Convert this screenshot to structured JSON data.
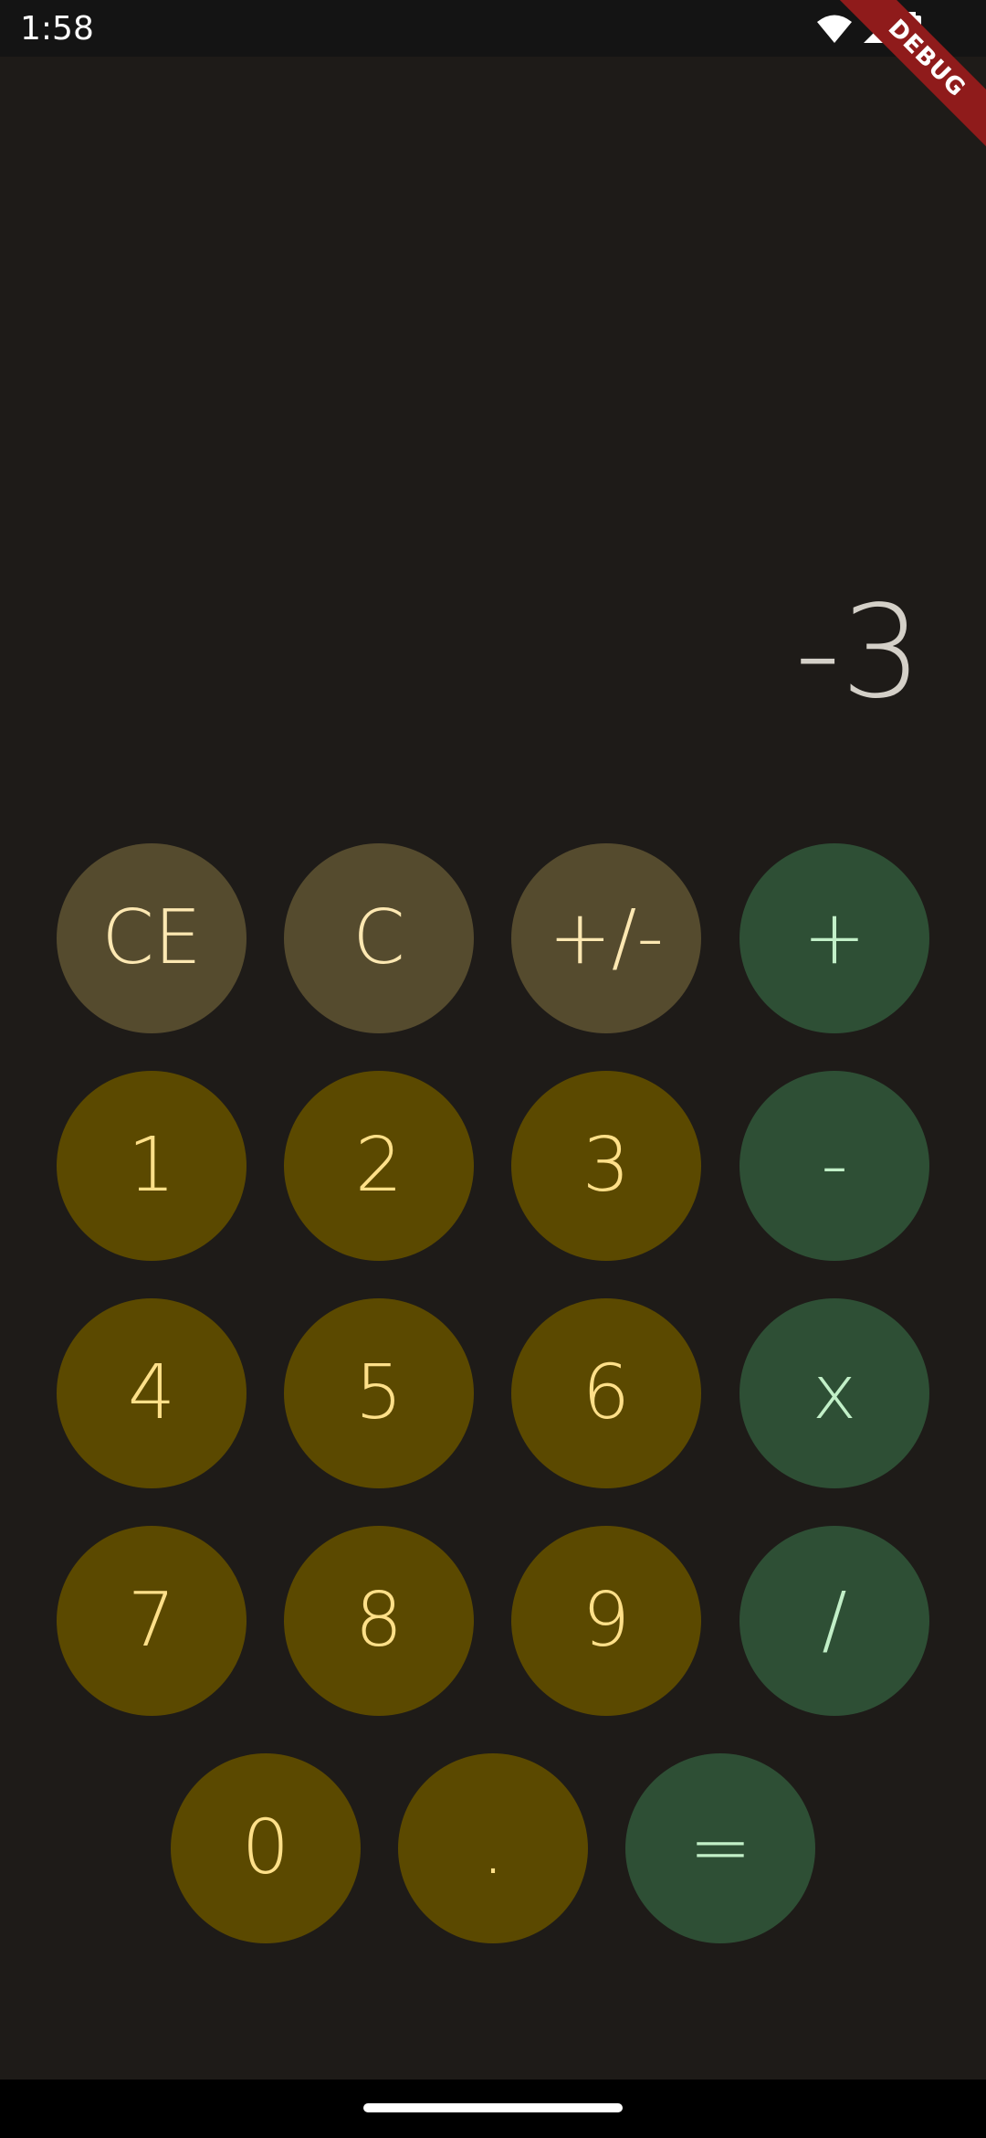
{
  "status_bar": {
    "time": "1:58",
    "icons": [
      "wifi-icon",
      "cell-signal-icon",
      "battery-icon"
    ]
  },
  "debug_banner": "DEBUG",
  "display": {
    "value": "-3"
  },
  "keypad": {
    "ce": "CE",
    "c": "C",
    "negate": "+/-",
    "plus": "+",
    "one": "1",
    "two": "2",
    "three": "3",
    "minus": "-",
    "four": "4",
    "five": "5",
    "six": "6",
    "multiply": "x",
    "seven": "7",
    "eight": "8",
    "nine": "9",
    "divide": "/",
    "zero": "0",
    "decimal": ".",
    "equals": "="
  },
  "colors": {
    "background": "#1e1b18",
    "function_key": "#554b2e",
    "digit_key": "#5b4900",
    "operator_key": "#2e4f35",
    "display_text": "#d4d0c8"
  }
}
